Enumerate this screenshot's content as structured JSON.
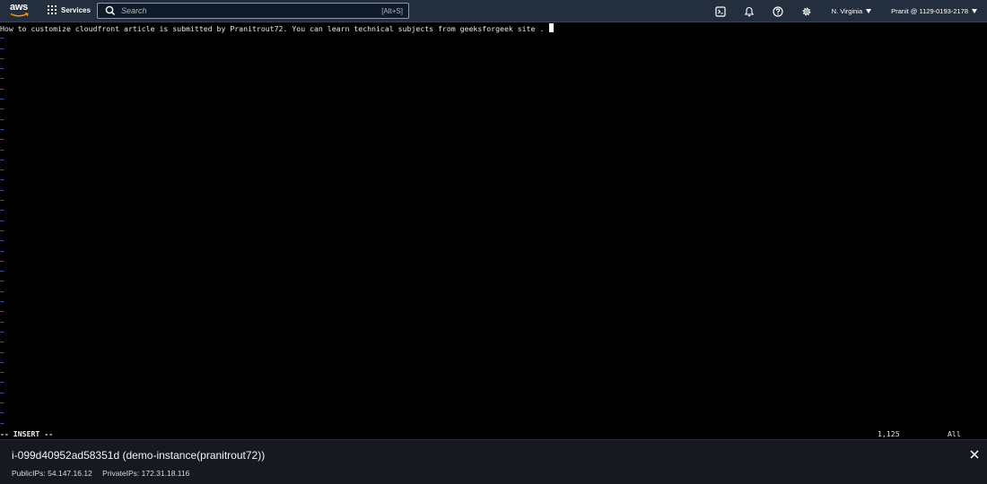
{
  "topnav": {
    "logo_text": "aws",
    "services_label": "Services",
    "search_placeholder": "Search",
    "search_shortcut": "[Alt+S]",
    "region": "N. Virginia",
    "account": "Pranit @ 1129-0193-2178",
    "icons": [
      "cloudshell-icon",
      "bell-icon",
      "help-icon",
      "gear-icon"
    ]
  },
  "terminal": {
    "line1": "How to customize cloudfront article is submitted by Pranitrout72. You can learn technical subjects from geeksforgeek site .",
    "tilde": "~",
    "mode": "-- INSERT --",
    "position": "1,125",
    "scroll": "All"
  },
  "instance": {
    "title": "i-099d40952ad58351d (demo-instance(pranitrout72))",
    "public_ips": "PublicIPs: 54.147.16.12",
    "private_ips": "PrivateIPs: 172.31.18.116"
  },
  "colors": {
    "nav_bg": "#232f3e",
    "tilde": "#4e86ff",
    "panel_bg": "#16191f"
  }
}
